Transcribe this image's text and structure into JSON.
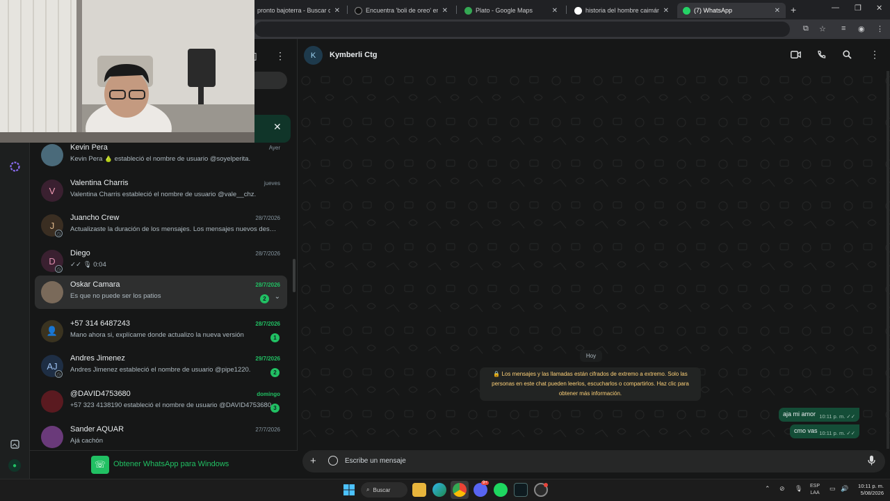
{
  "browser": {
    "tabs": [
      {
        "title": "pronto bajoterra - Buscar con G",
        "favicon_color": "#1e6fd9"
      },
      {
        "title": "Encuentra 'boli de oreo' en TikT",
        "favicon_color": "#111111"
      },
      {
        "title": "Plato - Google Maps",
        "favicon_color": "#34a853"
      },
      {
        "title": "historia del hombre caimán - B",
        "favicon_color": "#ffffff"
      },
      {
        "title": "(7) WhatsApp",
        "favicon_color": "#25d366"
      }
    ],
    "new_tab_label": "+",
    "close_glyph": "✕"
  },
  "whatsapp": {
    "chats": [
      {
        "name": "Kevin Pera",
        "time": "Ayer",
        "preview": "Kevin Pera 🍐 estableció el nombre de usuario @soyelperita.",
        "avatar_letter": "",
        "avatar_color": "#4a6a7a",
        "unread": "",
        "unread_time": false
      },
      {
        "name": "Valentina Charris",
        "time": "jueves",
        "preview": "Valentina Charris estableció el nombre de usuario @vale__chz.",
        "avatar_letter": "V",
        "avatar_color": "#3a2030",
        "avatar_text_color": "#f39bb4",
        "unread": "",
        "unread_time": false
      },
      {
        "name": "Juancho Crew",
        "time": "28/7/2026",
        "preview": "Actualizaste la duración de los mensajes. Los mensajes nuevos desaparecerán",
        "avatar_letter": "J",
        "avatar_color": "#3a2e22",
        "avatar_text_color": "#e0b98c",
        "unread": "",
        "unread_time": false,
        "timer": true
      },
      {
        "name": "Diego",
        "time": "28/7/2026",
        "preview": "✓✓ 🎙 0:04",
        "avatar_letter": "D",
        "avatar_color": "#3a2030",
        "avatar_text_color": "#e08fb0",
        "unread": "",
        "unread_time": false,
        "timer": true
      },
      {
        "name": "Oskar Camara",
        "time": "28/7/2026",
        "preview": "Es que no puede ser los patios",
        "avatar_letter": "",
        "avatar_color": "#7a6a5a",
        "unread": "2",
        "unread_time": true,
        "selected": true
      },
      {
        "name": "+57 314 6487243",
        "time": "28/7/2026",
        "preview": "Mano ahora si, explícame donde actualizo la nueva versión",
        "avatar_letter": "👤",
        "avatar_color": "#3a3320",
        "avatar_text_color": "#e8c77a",
        "unread": "1",
        "unread_time": true
      },
      {
        "name": "Andres Jimenez",
        "time": "29/7/2026",
        "preview": "Andres Jimenez estableció el nombre de usuario @pipe1220.",
        "avatar_letter": "AJ",
        "avatar_color": "#1e2e44",
        "avatar_text_color": "#9cc0f0",
        "unread": "2",
        "unread_time": true,
        "timer": true
      },
      {
        "name": "@DAVID4753680",
        "time": "domingo",
        "preview": "+57 323 4138190 estableció el nombre de usuario @DAVID4753680.",
        "avatar_letter": "",
        "avatar_color": "#5a1a20",
        "unread": "3",
        "unread_time": true
      },
      {
        "name": "Sander AQUAR",
        "time": "27/7/2026",
        "preview": "Ajá cachón",
        "avatar_letter": "",
        "avatar_color": "#6a3a7a",
        "unread": "",
        "unread_time": false
      }
    ],
    "get_app_label": "Obtener WhatsApp para Windows",
    "conversation": {
      "contact_name": "Kymberli Ctg",
      "contact_initial": "K",
      "day_label": "Hoy",
      "encryption_notice": "🔒 Los mensajes y las llamadas están cifrados de extremo a extremo. Solo las personas en este chat pueden leerlos, escucharlos o compartirlos. Haz clic para obtener más información.",
      "messages": [
        {
          "text": "aja mi amor",
          "time": "10:11 p. m.",
          "ticks": "✓✓"
        },
        {
          "text": "cmo vas",
          "time": "10:11 p. m.",
          "ticks": "✓✓"
        }
      ],
      "composer_placeholder": "Escribe un mensaje"
    }
  },
  "taskbar": {
    "search_label": "Buscar",
    "lang_line1": "ESP",
    "lang_line2": "LAA",
    "time": "10:11 p. m.",
    "date": "5/08/2026",
    "discord_badge": "9+"
  }
}
